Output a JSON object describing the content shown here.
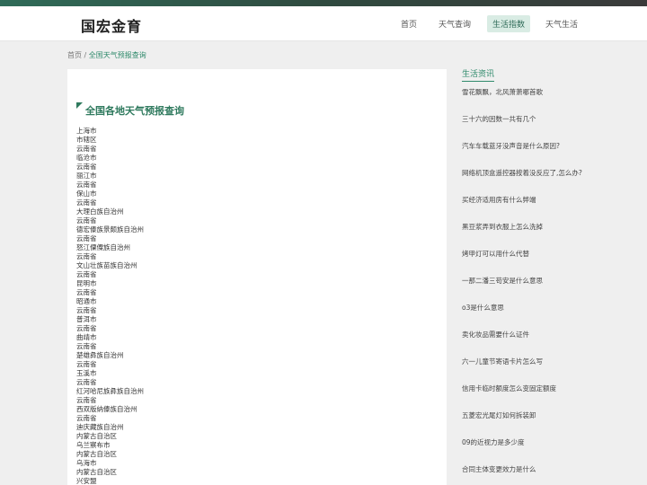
{
  "header": {
    "logo": "国宏金育",
    "nav": [
      {
        "label": "首页"
      },
      {
        "label": "天气查询"
      },
      {
        "label": "生活指数"
      },
      {
        "label": "天气生活"
      }
    ]
  },
  "breadcrumb": {
    "home": "首页",
    "separator": " / ",
    "current": "全国天气预报查询"
  },
  "main": {
    "title": "全国各地天气预报查询",
    "items": [
      "上海市",
      "市辖区",
      "云南省",
      "临沧市",
      "云南省",
      "丽江市",
      "云南省",
      "保山市",
      "云南省",
      "大理白族自治州",
      "云南省",
      "德宏傣族景颇族自治州",
      "云南省",
      "怒江傈僳族自治州",
      "云南省",
      "文山壮族苗族自治州",
      "云南省",
      "昆明市",
      "云南省",
      "昭通市",
      "云南省",
      "普洱市",
      "云南省",
      "曲靖市",
      "云南省",
      "楚雄彝族自治州",
      "云南省",
      "玉溪市",
      "云南省",
      "红河哈尼族彝族自治州",
      "云南省",
      "西双版纳傣族自治州",
      "云南省",
      "迪庆藏族自治州",
      "内蒙古自治区",
      "乌兰察布市",
      "内蒙古自治区",
      "乌海市",
      "内蒙古自治区",
      "兴安盟"
    ]
  },
  "sidebar": {
    "title": "生活资讯",
    "items": [
      "雪花飘飘，北风萧萧哪首歌",
      "三十六的因数一共有几个",
      "汽车车载蓝牙没声音是什么原因?",
      "网络机顶盒遥控器按着没反应了,怎么办?",
      "买经济适用房有什么弊端",
      "黑豆浆弄到衣服上怎么洗掉",
      "烤甲灯可以用什么代替",
      "一那二潘三苟安是什么意思",
      "o3是什么意思",
      "卖化妆品需要什么证件",
      "六一儿童节寄语卡片怎么写",
      "信用卡临时额度怎么变固定额度",
      "五菱宏光尾灯如何拆装卸",
      "09的近视力是多少度",
      "合同主体变更效力是什么"
    ]
  }
}
